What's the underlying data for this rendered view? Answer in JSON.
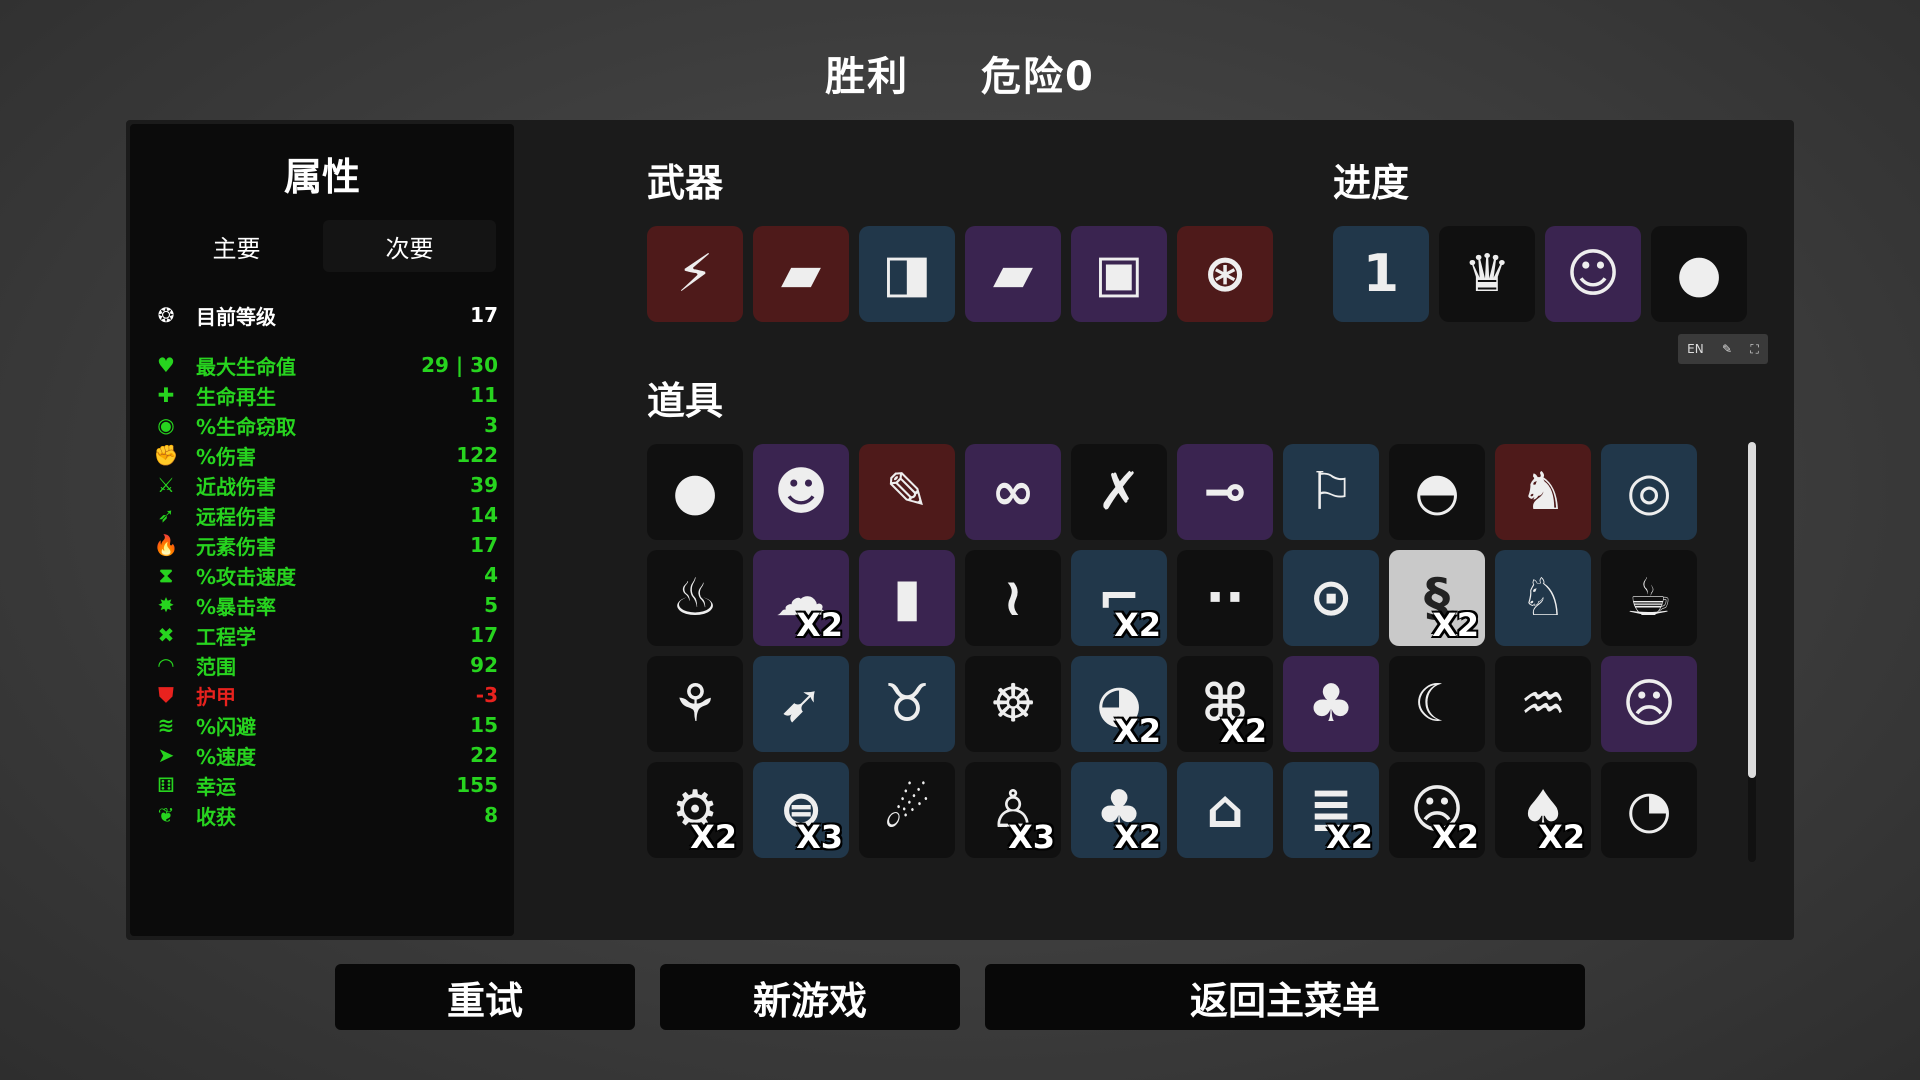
{
  "header": {
    "result": "胜利",
    "danger": "危险0"
  },
  "stats": {
    "title": "属性",
    "tabs": [
      {
        "label": "主要",
        "active": false
      },
      {
        "label": "次要",
        "active": true
      }
    ],
    "rows": [
      {
        "icon": "level-icon",
        "glyph": "❂",
        "label": "目前等级",
        "value": "17",
        "color": "white"
      },
      {
        "icon": "heart-icon",
        "glyph": "♥",
        "label": "最大生命值",
        "value": "29 | 30",
        "color": "green"
      },
      {
        "icon": "regen-icon",
        "glyph": "✚",
        "label": "生命再生",
        "value": "11",
        "color": "green"
      },
      {
        "icon": "lifesteal-icon",
        "glyph": "◉",
        "label": "%生命窃取",
        "value": "3",
        "color": "green"
      },
      {
        "icon": "damage-icon",
        "glyph": "✊",
        "label": "%伤害",
        "value": "122",
        "color": "green"
      },
      {
        "icon": "melee-icon",
        "glyph": "⚔",
        "label": "近战伤害",
        "value": "39",
        "color": "green"
      },
      {
        "icon": "ranged-icon",
        "glyph": "➶",
        "label": "远程伤害",
        "value": "14",
        "color": "green"
      },
      {
        "icon": "elemental-icon",
        "glyph": "🔥",
        "label": "元素伤害",
        "value": "17",
        "color": "green"
      },
      {
        "icon": "attack-speed-icon",
        "glyph": "⧗",
        "label": "%攻击速度",
        "value": "4",
        "color": "green"
      },
      {
        "icon": "crit-icon",
        "glyph": "✸",
        "label": "%暴击率",
        "value": "5",
        "color": "green"
      },
      {
        "icon": "engineering-icon",
        "glyph": "✖",
        "label": "工程学",
        "value": "17",
        "color": "green"
      },
      {
        "icon": "range-icon",
        "glyph": "◠",
        "label": "范围",
        "value": "92",
        "color": "green"
      },
      {
        "icon": "armor-icon",
        "glyph": "⛊",
        "label": "护甲",
        "value": "-3",
        "color": "red"
      },
      {
        "icon": "dodge-icon",
        "glyph": "≋",
        "label": "%闪避",
        "value": "15",
        "color": "green"
      },
      {
        "icon": "speed-icon",
        "glyph": "➤",
        "label": "%速度",
        "value": "22",
        "color": "green"
      },
      {
        "icon": "luck-icon",
        "glyph": "⚅",
        "label": "幸运",
        "value": "155",
        "color": "green"
      },
      {
        "icon": "harvest-icon",
        "glyph": "❦",
        "label": "收获",
        "value": "8",
        "color": "green"
      }
    ]
  },
  "weapons": {
    "title": "武器",
    "items": [
      {
        "icon": "lightning-wand-icon",
        "glyph": "⚡",
        "tier": "red"
      },
      {
        "icon": "pistol-icon",
        "glyph": "▰",
        "tier": "red"
      },
      {
        "icon": "revolver-icon",
        "glyph": "◨",
        "tier": "blue"
      },
      {
        "icon": "laser-pistol-icon",
        "glyph": "▰",
        "tier": "purple"
      },
      {
        "icon": "shredder-gun-icon",
        "glyph": "▣",
        "tier": "purple"
      },
      {
        "icon": "minigun-icon",
        "glyph": "⊛",
        "tier": "red"
      }
    ]
  },
  "progress": {
    "title": "进度",
    "items": [
      {
        "icon": "wave-number-icon",
        "glyph": "1",
        "tier": "blue"
      },
      {
        "icon": "king-character-icon",
        "glyph": "♛",
        "tier": "black"
      },
      {
        "icon": "cat-companion-icon",
        "glyph": "☺",
        "tier": "purple"
      },
      {
        "icon": "egg-icon",
        "glyph": "●",
        "tier": "black"
      }
    ]
  },
  "lang_widget": {
    "label": "EN"
  },
  "items": {
    "title": "道具",
    "grid": [
      {
        "icon": "egg-icon",
        "glyph": "●",
        "tier": "black",
        "count": ""
      },
      {
        "icon": "bearded-face-icon",
        "glyph": "☻",
        "tier": "purple",
        "count": ""
      },
      {
        "icon": "scroll-icon",
        "glyph": "✎",
        "tier": "red",
        "count": ""
      },
      {
        "icon": "handcuffs-icon",
        "glyph": "∞",
        "tier": "purple",
        "count": ""
      },
      {
        "icon": "red-scratch-icon",
        "glyph": "✗",
        "tier": "black",
        "count": ""
      },
      {
        "icon": "cannon-icon",
        "glyph": "⊸",
        "tier": "purple",
        "count": ""
      },
      {
        "icon": "white-flag-icon",
        "glyph": "⚐",
        "tier": "blue",
        "count": ""
      },
      {
        "icon": "propeller-hat-icon",
        "glyph": "◓",
        "tier": "black",
        "count": ""
      },
      {
        "icon": "mammoth-icon",
        "glyph": "♞",
        "tier": "red",
        "count": ""
      },
      {
        "icon": "black-belt-icon",
        "glyph": "◎",
        "tier": "blue",
        "count": ""
      },
      {
        "icon": "poop-icon",
        "glyph": "♨",
        "tier": "black",
        "count": ""
      },
      {
        "icon": "tardigrade-icon",
        "glyph": "☁",
        "tier": "purple",
        "count": "X2"
      },
      {
        "icon": "bullet-icon",
        "glyph": "▮",
        "tier": "purple",
        "count": ""
      },
      {
        "icon": "flamingo-icon",
        "glyph": "≀",
        "tier": "black",
        "count": ""
      },
      {
        "icon": "robot-arm-icon",
        "glyph": "⌐",
        "tier": "blue",
        "count": "X2"
      },
      {
        "icon": "shadow-eyes-icon",
        "glyph": "∙∙",
        "tier": "black",
        "count": ""
      },
      {
        "icon": "spyglass-icon",
        "glyph": "⊙",
        "tier": "blue",
        "count": ""
      },
      {
        "icon": "snake-icon",
        "glyph": "§",
        "tier": "white",
        "count": "X2"
      },
      {
        "icon": "rabbit-icon",
        "glyph": "♘",
        "tier": "blue",
        "count": ""
      },
      {
        "icon": "coffee-cup-icon",
        "glyph": "☕",
        "tier": "black",
        "count": ""
      },
      {
        "icon": "sprout-icon",
        "glyph": "⚘",
        "tier": "black",
        "count": ""
      },
      {
        "icon": "rocket-icon",
        "glyph": "➹",
        "tier": "blue",
        "count": ""
      },
      {
        "icon": "piggy-bank-icon",
        "glyph": "♉",
        "tier": "blue",
        "count": ""
      },
      {
        "icon": "monkey-icon",
        "glyph": "☸",
        "tier": "black",
        "count": ""
      },
      {
        "icon": "grenade-icon",
        "glyph": "◕",
        "tier": "blue",
        "count": "X2"
      },
      {
        "icon": "treasure-map-icon",
        "glyph": "⌘",
        "tier": "black",
        "count": "X2"
      },
      {
        "icon": "four-leaf-clover-icon",
        "glyph": "♣",
        "tier": "purple",
        "count": ""
      },
      {
        "icon": "crescent-moon-icon",
        "glyph": "☾",
        "tier": "black",
        "count": ""
      },
      {
        "icon": "cauldron-icon",
        "glyph": "♒",
        "tier": "black",
        "count": ""
      },
      {
        "icon": "ghost-icon",
        "glyph": "☹",
        "tier": "purple",
        "count": ""
      },
      {
        "icon": "turret-icon",
        "glyph": "⚙",
        "tier": "black",
        "count": "X2"
      },
      {
        "icon": "helmet-icon",
        "glyph": "⊜",
        "tier": "blue",
        "count": "X3"
      },
      {
        "icon": "hamster-icon",
        "glyph": "☄",
        "tier": "black",
        "count": ""
      },
      {
        "icon": "alien-icon",
        "glyph": "♙",
        "tier": "black",
        "count": "X3"
      },
      {
        "icon": "garden-icon",
        "glyph": "♣",
        "tier": "blue",
        "count": "X2"
      },
      {
        "icon": "bunker-icon",
        "glyph": "⌂",
        "tier": "blue",
        "count": ""
      },
      {
        "icon": "claw-icon",
        "glyph": "≣",
        "tier": "blue",
        "count": "X2"
      },
      {
        "icon": "scared-face-icon",
        "glyph": "☹",
        "tier": "black",
        "count": "X2"
      },
      {
        "icon": "tree-icon",
        "glyph": "♠",
        "tier": "black",
        "count": "X2"
      },
      {
        "icon": "rubber-duck-icon",
        "glyph": "◔",
        "tier": "black",
        "count": ""
      }
    ]
  },
  "buttons": {
    "retry": "重试",
    "new_game": "新游戏",
    "main_menu": "返回主菜单"
  },
  "colors": {
    "white": "#ffffff",
    "green": "#27d41f",
    "red": "#e8221e",
    "tier_black": "#101010",
    "tier_blue": "#21374a",
    "tier_purple": "#3a2450",
    "tier_red": "#4e1a1a",
    "tier_white": "#c9c9c9",
    "count_text": "#ffffff"
  }
}
